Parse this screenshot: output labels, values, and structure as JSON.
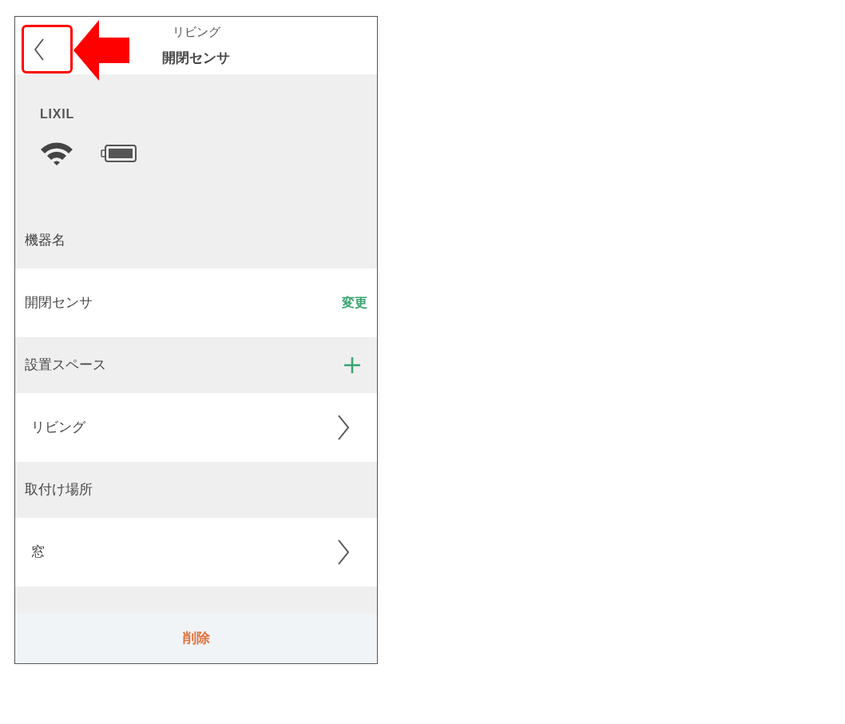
{
  "header": {
    "subtitle": "リビング",
    "title": "開閉センサ"
  },
  "device": {
    "brand": "LIXIL"
  },
  "sections": [
    {
      "label": "機器名",
      "kind": "plain",
      "row": {
        "value": "開閉センサ",
        "kind": "edit",
        "action": "変更"
      }
    },
    {
      "label": "設置スペース",
      "kind": "addable",
      "row": {
        "value": "リビング",
        "kind": "nav"
      }
    },
    {
      "label": "取付け場所",
      "kind": "plain",
      "row": {
        "value": "窓",
        "kind": "nav"
      }
    }
  ],
  "footer": {
    "button": "削除"
  }
}
